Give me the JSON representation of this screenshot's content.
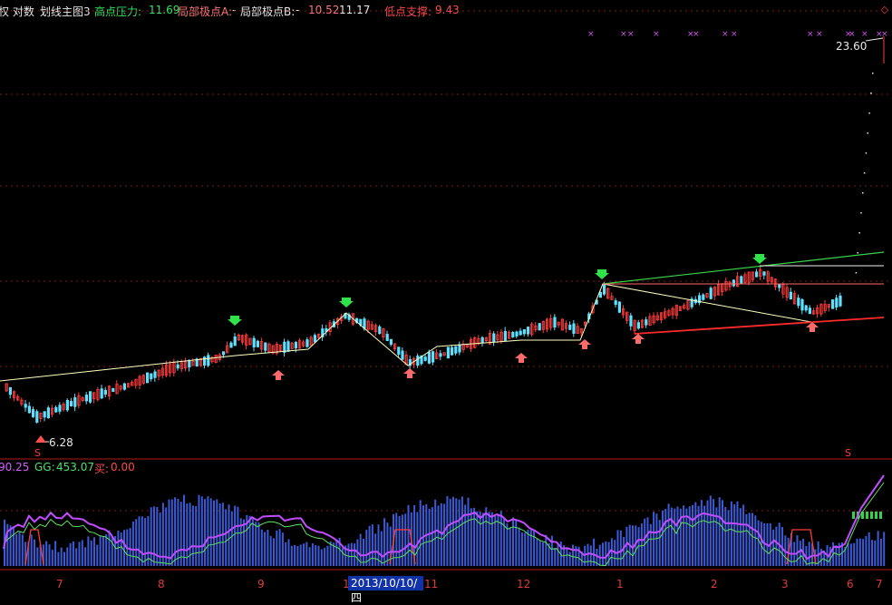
{
  "header": {
    "prefix": "权 对数",
    "indicator_name": "划线主图3",
    "high_pressure_label": "高点压力:",
    "high_pressure_value": "11.69",
    "local_a_label": "局部极点A:",
    "local_a_value": "-",
    "local_b_label": "局部极点B:",
    "local_b_value": "-",
    "local_b_v1": "10.52",
    "local_b_v2": "11.17",
    "low_support_label": "低点支撑:",
    "low_support_value": "9.43",
    "corner_icon": "diamond-icon"
  },
  "main_chart": {
    "max_label": "23.60",
    "min_label": "6.28",
    "s_marker": "S",
    "colors": {
      "up_candle": "#ff3b3b",
      "down_candle": "#5fe0ff",
      "trend_line": "#ffffc0",
      "support_line": "#ff2a2a",
      "resistance_line": "#3ad24a",
      "grid": "#7a1a1a"
    }
  },
  "sub_chart": {
    "v1": "90.25",
    "gg_label": "GG:",
    "gg_value": "453.07",
    "buy_label": "买:",
    "buy_value": "0.00"
  },
  "xaxis": {
    "ticks": [
      "7",
      "8",
      "9",
      "1",
      "11",
      "12",
      "1",
      "2",
      "3",
      "6",
      "7"
    ],
    "cursor_date": "2013/10/10/四"
  }
}
